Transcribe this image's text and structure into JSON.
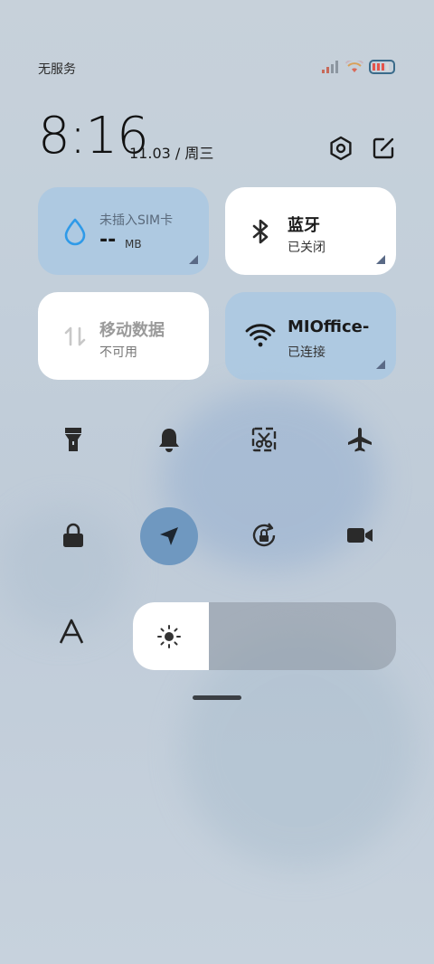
{
  "status_bar": {
    "carrier": "无服务"
  },
  "header": {
    "time": "8:16",
    "date": "11.03 / 周三"
  },
  "tiles": {
    "data_usage": {
      "title": "未插入SIM卡",
      "value": "--",
      "unit": "MB"
    },
    "bluetooth": {
      "title": "蓝牙",
      "status": "已关闭"
    },
    "mobile_data": {
      "title": "移动数据",
      "status": "不可用"
    },
    "wifi": {
      "title": "MIOffice-",
      "status": "已连接"
    }
  },
  "brightness_level": 0.29,
  "colors": {
    "tile_on": "#ffffff",
    "tile_off": "#aac8e2",
    "accent_blue": "#3b9ee8",
    "location_active": "#6f98c0"
  }
}
